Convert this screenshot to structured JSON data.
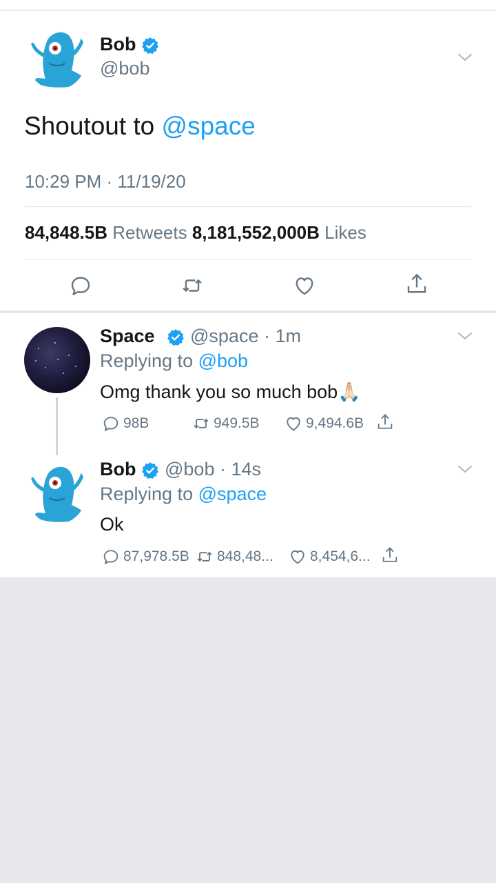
{
  "main_tweet": {
    "author_name": "Bob",
    "author_handle": "@bob",
    "text_prefix": "Shoutout to ",
    "mention": "@space",
    "timestamp": "10:29 PM · 11/19/20",
    "retweets_count": "84,848.5B",
    "retweets_label": "Retweets",
    "likes_count": "8,181,552,000B",
    "likes_label": "Likes"
  },
  "replies": [
    {
      "author_name": "Space",
      "author_meta": "@space · 1m",
      "replying_prefix": "Replying to ",
      "replying_to": "@bob",
      "text": "Omg thank you so much bob🙏🏻",
      "reply_count": "98B",
      "retweet_count": "949.5B",
      "like_count": "9,494.6B"
    },
    {
      "author_name": "Bob",
      "author_meta": "@bob · 14s",
      "replying_prefix": "Replying to ",
      "replying_to": "@space",
      "text": "Ok",
      "reply_count": "87,978.5B",
      "retweet_count": "848,48...",
      "like_count": "8,454,6..."
    }
  ],
  "icons": {
    "reply": "reply-icon",
    "retweet": "retweet-icon",
    "like": "heart-icon",
    "share": "share-icon",
    "verified": "verified-badge-icon",
    "more": "chevron-down-icon"
  },
  "colors": {
    "accent": "#1da1f2",
    "secondary_text": "#657786",
    "primary_text": "#14171a",
    "background": "#e6e8ee"
  }
}
